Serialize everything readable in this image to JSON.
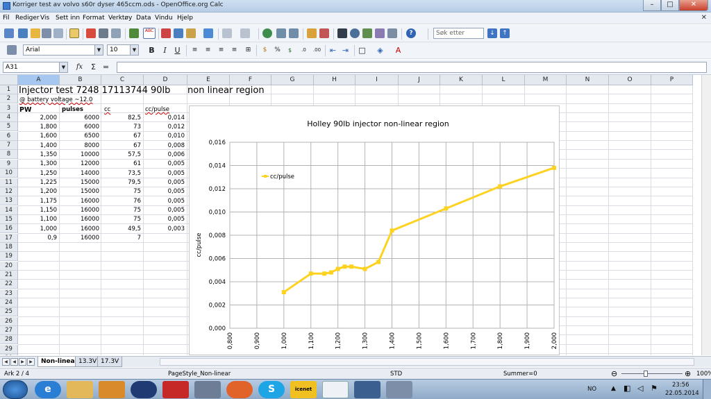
{
  "window": {
    "title": "Korriger test av volvo s60r dyser 465ccm.ods - OpenOffice.org Calc"
  },
  "menu": [
    "Fil",
    "Rediger",
    "Vis",
    "Sett inn",
    "Format",
    "Verktøy",
    "Data",
    "Vindu",
    "Hjelp"
  ],
  "toolbar": {
    "find_placeholder": "Søk etter",
    "font_name": "Arial",
    "font_size": "10"
  },
  "formula_bar": {
    "cell_ref": "A31",
    "sum_symbol": "Σ",
    "equals_symbol": "=",
    "content": ""
  },
  "columns": [
    "A",
    "B",
    "C",
    "D",
    "E",
    "F",
    "G",
    "H",
    "I",
    "J",
    "K",
    "L",
    "M",
    "N",
    "O",
    "P"
  ],
  "rows": [
    "1",
    "2",
    "3",
    "4",
    "5",
    "6",
    "7",
    "8",
    "9",
    "10",
    "11",
    "12",
    "13",
    "14",
    "15",
    "16",
    "17",
    "18",
    "19",
    "20",
    "21",
    "22",
    "23",
    "24",
    "25",
    "26",
    "27",
    "28",
    "29",
    "30"
  ],
  "sheet": {
    "row1": {
      "title": "Injector test 7248 17113744  90lb",
      "e": "non linear region"
    },
    "row2": {
      "a": "@ battery voltage ~12.0"
    },
    "headers": {
      "a": "PW",
      "b": "pulses",
      "c": "cc",
      "d": "cc/pulse"
    },
    "data": [
      [
        "2,000",
        "6000",
        "82,5",
        "0,014"
      ],
      [
        "1,800",
        "6000",
        "73",
        "0,012"
      ],
      [
        "1,600",
        "6500",
        "67",
        "0,010"
      ],
      [
        "1,400",
        "8000",
        "67",
        "0,008"
      ],
      [
        "1,350",
        "10000",
        "57,5",
        "0,006"
      ],
      [
        "1,300",
        "12000",
        "61",
        "0,005"
      ],
      [
        "1,250",
        "14000",
        "73,5",
        "0,005"
      ],
      [
        "1,225",
        "15000",
        "79,5",
        "0,005"
      ],
      [
        "1,200",
        "15000",
        "75",
        "0,005"
      ],
      [
        "1,175",
        "16000",
        "76",
        "0,005"
      ],
      [
        "1,150",
        "16000",
        "75",
        "0,005"
      ],
      [
        "1,100",
        "16000",
        "75",
        "0,005"
      ],
      [
        "1,000",
        "16000",
        "49,5",
        "0,003"
      ],
      [
        "0,9",
        "16000",
        "7",
        ""
      ]
    ]
  },
  "chart_data": {
    "type": "line",
    "title": "Holley 90lb injector non-linear region",
    "xlabel": "PW",
    "ylabel": "cc/pulse",
    "xlim": [
      0.8,
      2.0
    ],
    "ylim": [
      0,
      0.016
    ],
    "x_ticks": [
      "0,800",
      "0,900",
      "1,000",
      "1,100",
      "1,200",
      "1,300",
      "1,400",
      "1,500",
      "1,600",
      "1,700",
      "1,800",
      "1,900",
      "2,000"
    ],
    "y_ticks": [
      "0,000",
      "0,002",
      "0,004",
      "0,006",
      "0,008",
      "0,010",
      "0,012",
      "0,014",
      "0,016"
    ],
    "legend_position": "top-left",
    "grid": true,
    "series": [
      {
        "name": "cc/pulse",
        "color": "#fdd221",
        "x": [
          1.0,
          1.1,
          1.15,
          1.175,
          1.2,
          1.225,
          1.25,
          1.3,
          1.35,
          1.4,
          1.6,
          1.8,
          2.0
        ],
        "y": [
          0.0031,
          0.0047,
          0.0047,
          0.0048,
          0.0051,
          0.0053,
          0.0053,
          0.0051,
          0.0057,
          0.0084,
          0.0103,
          0.0122,
          0.0138
        ]
      }
    ]
  },
  "sheet_tabs": [
    "Non-linear",
    "13.3V",
    "17.3V"
  ],
  "status": {
    "sheet": "Ark 2 / 4",
    "page_style": "PageStyle_Non-linear",
    "mode": "STD",
    "sum": "Summer=0",
    "zoom": "100%"
  },
  "taskbar": {
    "lang": "NO",
    "time": "23:56",
    "date": "22.05.2014",
    "icenet": "icenet"
  },
  "colors": {
    "series": "#fdd221",
    "selection": "#a6c7ef"
  }
}
